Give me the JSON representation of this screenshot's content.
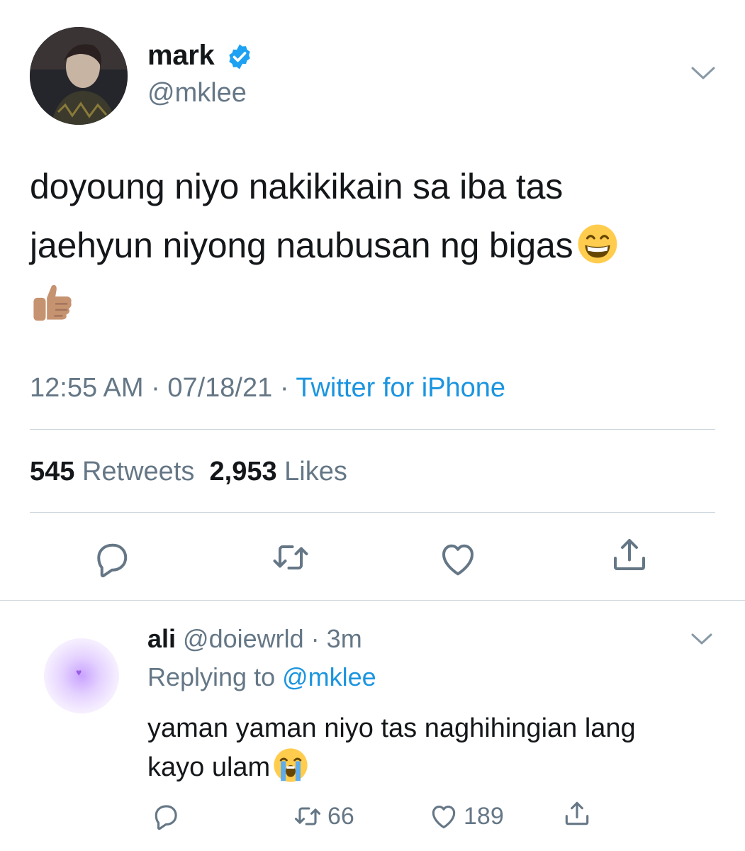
{
  "tweet": {
    "author_name": "mark",
    "author_handle": "@mklee",
    "text_line1": "doyoung niyo nakikikain sa iba tas",
    "text_line2": "jaehyun niyong naubusan ng bigas",
    "time": "12:55 AM",
    "date": "07/18/21",
    "source": "Twitter for iPhone",
    "retweets_count": "545",
    "retweets_label": "Retweets",
    "likes_count": "2,953",
    "likes_label": "Likes"
  },
  "icons": {
    "verified": "verified-badge-icon",
    "chevron": "chevron-down-icon",
    "reply": "speech-bubble-icon",
    "retweet": "retweet-arrows-icon",
    "like": "heart-outline-icon",
    "share": "share-upload-icon",
    "emoji_grin": "grinning-face-emoji",
    "emoji_thumb": "thumbs-up-emoji",
    "emoji_sob": "loudly-crying-face-emoji"
  },
  "reply": {
    "author_name": "ali",
    "author_handle": "@doiewrld",
    "time_ago": "3m",
    "replying_prefix": "Replying to",
    "replying_to": "@mklee",
    "text_line1": "yaman yaman niyo tas naghihingian lang",
    "text_line2": "kayo ulam",
    "retweets_count": "66",
    "likes_count": "189"
  },
  "colors": {
    "accent": "#1b95e0",
    "secondary_text": "#657786",
    "primary_text": "#14171a",
    "divider": "#ccd6dd"
  }
}
